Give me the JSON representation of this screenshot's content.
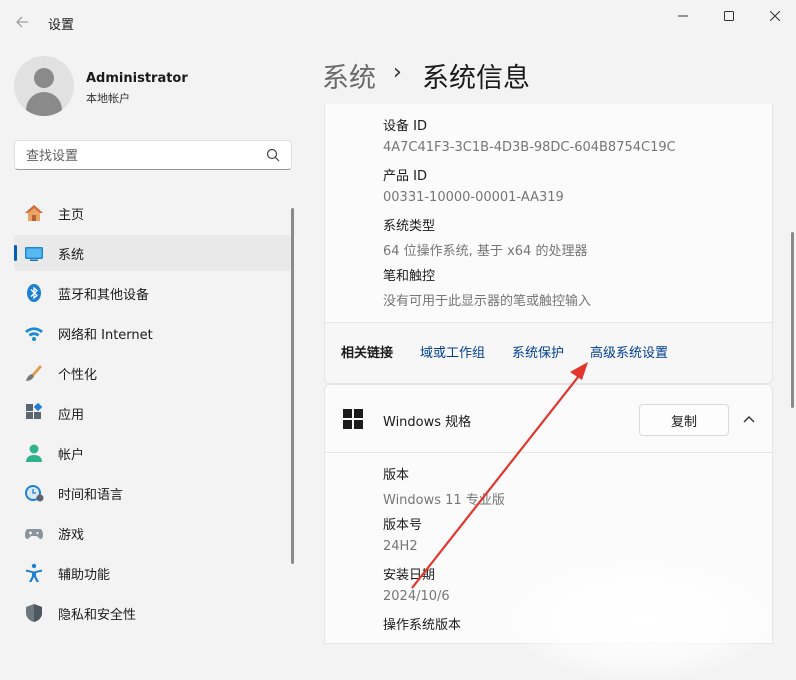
{
  "window": {
    "title": "设置",
    "back_icon": "back-arrow-icon",
    "minimize_icon": "minimize-icon",
    "maximize_icon": "maximize-icon",
    "close_icon": "close-icon"
  },
  "profile": {
    "name": "Administrator",
    "account_type": "本地帐户"
  },
  "search": {
    "placeholder": "查找设置",
    "icon": "search-icon"
  },
  "sidebar": {
    "items": [
      {
        "label": "主页",
        "icon": "home-icon",
        "active": false
      },
      {
        "label": "系统",
        "icon": "system-display-icon",
        "active": true
      },
      {
        "label": "蓝牙和其他设备",
        "icon": "bluetooth-icon",
        "active": false
      },
      {
        "label": "网络和 Internet",
        "icon": "wifi-icon",
        "active": false
      },
      {
        "label": "个性化",
        "icon": "brush-icon",
        "active": false
      },
      {
        "label": "应用",
        "icon": "apps-icon",
        "active": false
      },
      {
        "label": "帐户",
        "icon": "account-icon",
        "active": false
      },
      {
        "label": "时间和语言",
        "icon": "time-language-icon",
        "active": false
      },
      {
        "label": "游戏",
        "icon": "gamepad-icon",
        "active": false
      },
      {
        "label": "辅助功能",
        "icon": "accessibility-icon",
        "active": false
      },
      {
        "label": "隐私和安全性",
        "icon": "shield-icon",
        "active": false
      }
    ]
  },
  "breadcrumb": {
    "parent": "系统",
    "separator": "›",
    "current": "系统信息"
  },
  "device_specs": {
    "rows": [
      {
        "label": "设备 ID",
        "value": "4A7C41F3-3C1B-4D3B-98DC-604B8754C19C"
      },
      {
        "label": "产品 ID",
        "value": "00331-10000-00001-AA319"
      },
      {
        "label": "系统类型",
        "value": "64 位操作系统, 基于 x64 的处理器"
      },
      {
        "label": "笔和触控",
        "value": "没有可用于此显示器的笔或触控输入"
      }
    ]
  },
  "related_links": {
    "title": "相关链接",
    "links": [
      "域或工作组",
      "系统保护",
      "高级系统设置"
    ]
  },
  "windows_specs": {
    "title": "Windows 规格",
    "copy_label": "复制",
    "rows": [
      {
        "label": "版本",
        "value": "Windows 11 专业版"
      },
      {
        "label": "版本号",
        "value": "24H2"
      },
      {
        "label": "安装日期",
        "value": "2024/10/6"
      },
      {
        "label": "操作系统版本",
        "value": ""
      }
    ]
  },
  "colors": {
    "accent": "#005fb8",
    "link": "#003e92",
    "annotation_arrow": "#e2352b"
  }
}
